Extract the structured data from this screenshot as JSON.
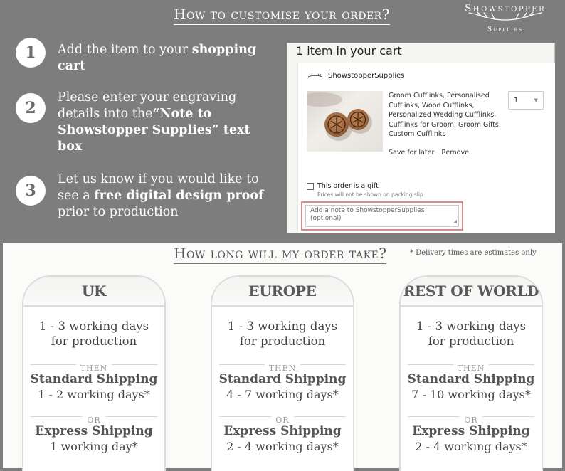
{
  "top": {
    "title": "How to customise your order?",
    "brand": {
      "name": "Showstopper",
      "sub": "Supplies"
    },
    "steps": [
      {
        "num": "1",
        "parts": [
          "Add the item to your ",
          "shopping cart",
          ""
        ]
      },
      {
        "num": "2",
        "parts": [
          "Please enter your engraving details into the",
          "“Note to Showstopper Supplies” text box",
          ""
        ]
      },
      {
        "num": "3",
        "parts": [
          "Let us know if you would like to see a ",
          "free digital design proof",
          " prior to production"
        ]
      }
    ]
  },
  "cart": {
    "heading": "1 item in your cart",
    "shop_name": "ShowstopperSupplies",
    "product_title": "Groom Cufflinks, Personalised Cufflinks, Wood Cufflinks, Personalized Wedding Cufflinks, Cufflinks for Groom, Groom Gifts, Custom Cufflinks",
    "quantity": "1",
    "save_for_later": "Save for later",
    "remove": "Remove",
    "gift_label": "This order is a gift",
    "gift_note": "Prices will not be shown on packing slip",
    "note_placeholder": "Add a note to ShowstopperSupplies (optional)"
  },
  "delivery": {
    "title": "How long will my order take?",
    "note": "* Delivery times are estimates only",
    "then_label": "THEN",
    "or_label": "OR",
    "regions": [
      {
        "name": "UK",
        "production": "1 - 3 working days for production",
        "standard_name": "Standard Shipping",
        "standard_days": "1 - 2 working days*",
        "express_name": "Express Shipping",
        "express_days": "1 working day*"
      },
      {
        "name": "EUROPE",
        "production": "1 - 3 working days for production",
        "standard_name": "Standard Shipping",
        "standard_days": "4 - 7 working days*",
        "express_name": "Express Shipping",
        "express_days": "2 - 4 working days*"
      },
      {
        "name": "REST OF WORLD",
        "production": "1 - 3 working days for production",
        "standard_name": "Standard Shipping",
        "standard_days": "7 - 10 working days*",
        "express_name": "Express Shipping",
        "express_days": "2 - 4 working days*"
      }
    ]
  },
  "colors": {
    "top_background": "#7d7d7d",
    "highlight_border": "#d98a82"
  },
  "icons": {
    "brand": "antler-icon",
    "product": "cufflinks-photo",
    "quantity": "chevron-down-icon"
  }
}
